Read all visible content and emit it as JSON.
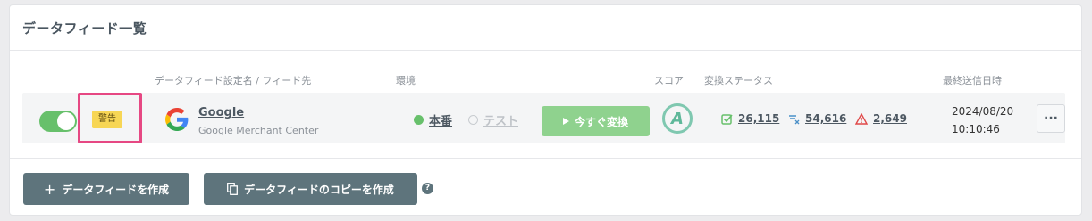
{
  "header": {
    "title": "データフィード一覧"
  },
  "columns": {
    "feed": "データフィード設定名 / フィード先",
    "env": "環境",
    "score": "スコア",
    "status": "変換ステータス",
    "last_sent": "最終送信日時"
  },
  "row": {
    "enabled": true,
    "badge": "警告",
    "feed_name": "Google",
    "feed_destination": "Google Merchant Center",
    "env_production": "本番",
    "env_test": "テスト",
    "env_selected": "本番",
    "convert_button": "今すぐ変換",
    "score": "A",
    "stat_success": "26,115",
    "stat_excluded": "54,616",
    "stat_error": "2,649",
    "date": "2024/08/20",
    "time": "10:10:46",
    "more": "···"
  },
  "footer": {
    "create_button": "データフィードを作成",
    "copy_button": "データフィードのコピーを作成",
    "help": "?"
  },
  "colors": {
    "toggle_on": "#67c06b",
    "badge_warning": "#f7d655",
    "highlight": "#e64883",
    "convert_button": "#8fd28e",
    "dark_button": "#5e747c",
    "error": "#e04848"
  },
  "icons": {
    "play": "play-icon",
    "plus": "plus-icon",
    "copy": "copy-icon",
    "help": "help-icon",
    "success": "check-square-icon",
    "excluded": "filter-x-icon",
    "error": "warning-triangle-icon"
  }
}
